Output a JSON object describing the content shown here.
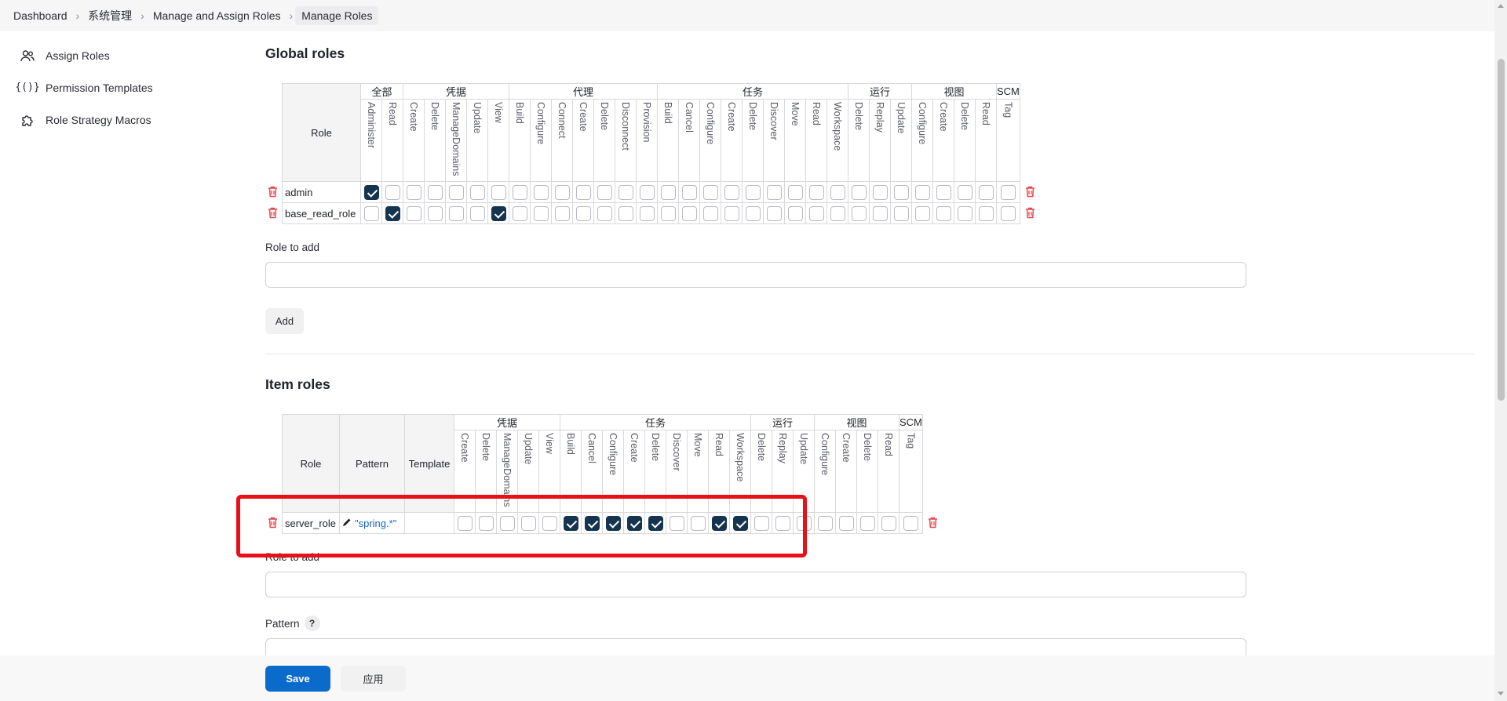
{
  "breadcrumb": [
    "Dashboard",
    "系统管理",
    "Manage and Assign Roles",
    "Manage Roles"
  ],
  "sidebar": {
    "items": [
      {
        "label": "Assign Roles",
        "icon": "users-icon"
      },
      {
        "label": "Permission Templates",
        "icon": "braces-icon"
      },
      {
        "label": "Role Strategy Macros",
        "icon": "puzzle-icon"
      }
    ]
  },
  "global_roles": {
    "title": "Global roles",
    "role_header": "Role",
    "groups": [
      {
        "label": "全部",
        "perms": [
          "Administer",
          "Read"
        ]
      },
      {
        "label": "凭据",
        "perms": [
          "Create",
          "Delete",
          "ManageDomains",
          "Update",
          "View"
        ]
      },
      {
        "label": "代理",
        "perms": [
          "Build",
          "Configure",
          "Connect",
          "Create",
          "Delete",
          "Disconnect",
          "Provision"
        ]
      },
      {
        "label": "任务",
        "perms": [
          "Build",
          "Cancel",
          "Configure",
          "Create",
          "Delete",
          "Discover",
          "Move",
          "Read",
          "Workspace"
        ]
      },
      {
        "label": "运行",
        "perms": [
          "Delete",
          "Replay",
          "Update"
        ]
      },
      {
        "label": "视图",
        "perms": [
          "Configure",
          "Create",
          "Delete",
          "Read"
        ]
      },
      {
        "label": "SCM",
        "perms": [
          "Tag"
        ]
      }
    ],
    "rows": [
      {
        "name": "admin",
        "checked": [
          0
        ]
      },
      {
        "name": "base_read_role",
        "checked": [
          1,
          6
        ]
      }
    ],
    "role_to_add_label": "Role to add",
    "add_button": "Add"
  },
  "item_roles": {
    "title": "Item roles",
    "role_header": "Role",
    "pattern_header": "Pattern",
    "template_header": "Template",
    "groups": [
      {
        "label": "凭据",
        "perms": [
          "Create",
          "Delete",
          "ManageDomains",
          "Update",
          "View"
        ]
      },
      {
        "label": "任务",
        "perms": [
          "Build",
          "Cancel",
          "Configure",
          "Create",
          "Delete",
          "Discover",
          "Move",
          "Read",
          "Workspace"
        ]
      },
      {
        "label": "运行",
        "perms": [
          "Delete",
          "Replay",
          "Update"
        ]
      },
      {
        "label": "视图",
        "perms": [
          "Configure",
          "Create",
          "Delete",
          "Read"
        ]
      },
      {
        "label": "SCM",
        "perms": [
          "Tag"
        ]
      }
    ],
    "rows": [
      {
        "name": "server_role",
        "pattern": "\"spring.*\"",
        "template": "",
        "checked": [
          5,
          6,
          7,
          8,
          9,
          12,
          13
        ]
      }
    ],
    "role_to_add_label": "Role to add",
    "pattern_label": "Pattern",
    "pattern_help": "?"
  },
  "footer": {
    "save": "Save",
    "apply": "应用"
  },
  "colors": {
    "checked": "#15344f",
    "primary": "#0b6bcb",
    "danger": "#e5484d",
    "highlight": "#e8101a"
  }
}
